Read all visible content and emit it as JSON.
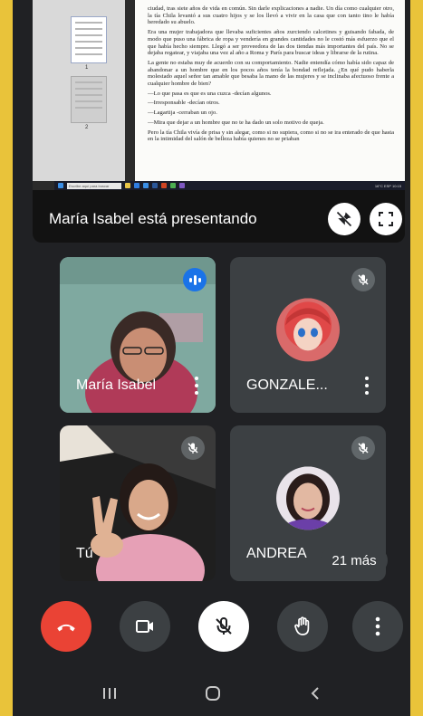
{
  "shared_screen": {
    "thumbnails": [
      {
        "number": "1"
      },
      {
        "number": "2"
      }
    ],
    "document_paragraphs": [
      "ciudad, tras siete años de vida en común. Sin darle explicaciones a nadie. Un día como cualquier otro, la tía Chila levantó a sus cuatro hijos y se los llevó a vivir en la casa que con tanto tino le había heredado su abuelo.",
      "Era una mujer trabajadora que llevaba suficientes años zurciendo calcetines y guisando fabada, de modo que puso una fábrica de ropa y vendería en grandes cantidades no le costó más esfuerzo que el que había hecho siempre. Llegó a ser proveedora de las dos tiendas más importantes del país. No se dejaba regatear, y viajaba una vez al año a Roma y París para buscar ideas y librarse de la rutina.",
      "La gente no estaba muy de acuerdo con su comportamiento. Nadie entendía cómo había sido capaz de abandonar a un hombre que en los pocos años tenía la bondad reflejada. ¿En qué pudo haberla molestado aquel señor tan amable que besaba la mano de las mujeres y se inclinaba afectuoso frente a cualquier hombre de bien?",
      "—Lo que pasa es que es una cuzca -decían algunos.",
      "—Irresponsable -decían otros.",
      "—Lagartija -cerraban un ojo.",
      "—Mira que dejar a un hombre que no te ha dado un solo motivo de queja.",
      "Pero la tía Chila vivía de prisa y sin alegar, como si no supiera, como si no se ira enterado de que hasta en la intimidad del salón de belleza había quienes no se priaban"
    ],
    "taskbar_search": "Escribe aquí para buscar",
    "taskbar_tray": "16°C  ESP  10:15"
  },
  "presenting": {
    "label": "María Isabel está presentando"
  },
  "tiles": [
    {
      "name": "María Isabel",
      "state": "speaking"
    },
    {
      "name": "GONZALE...",
      "state": "muted"
    },
    {
      "name": "Tú",
      "state": "muted"
    },
    {
      "name": "ANDREA",
      "state": "muted"
    }
  ],
  "more_participants": "21 más",
  "controls": {
    "end_call": "end-call",
    "camera": "camera",
    "mic": "mic-off",
    "raise_hand": "raise-hand",
    "more": "more-options"
  },
  "colors": {
    "page_background": "#e9c33a",
    "app_background": "#202124",
    "tile_background": "#3c4043",
    "end_call": "#ea4335",
    "speaking_badge": "#1a73e8"
  }
}
